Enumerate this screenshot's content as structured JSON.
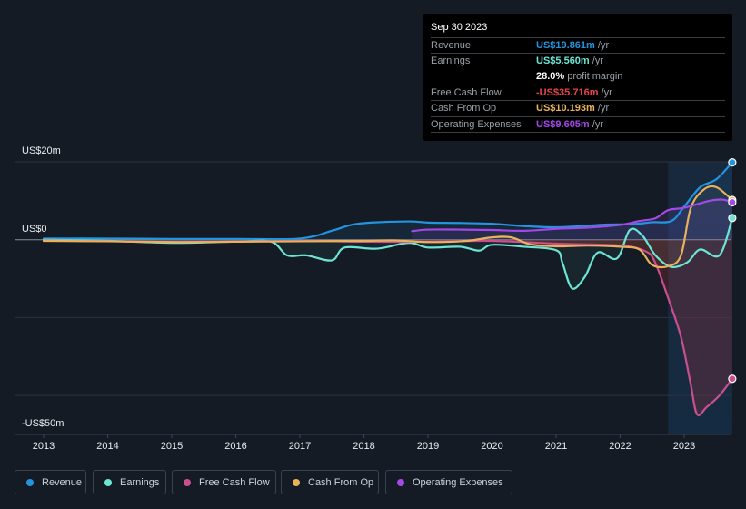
{
  "tooltip": {
    "date": "Sep 30 2023",
    "rows": [
      {
        "label": "Revenue",
        "value": "US$19.861m",
        "unit": " /yr",
        "color": "#2394df"
      },
      {
        "label": "Earnings",
        "value": "US$5.560m",
        "unit": " /yr",
        "color": "#6ce5d4"
      },
      {
        "label": "",
        "value": "28.0%",
        "unit": " profit margin",
        "color": "#ffffff"
      },
      {
        "label": "Free Cash Flow",
        "value": "-US$35.716m",
        "unit": " /yr",
        "color": "#e64545"
      },
      {
        "label": "Cash From Op",
        "value": "US$10.193m",
        "unit": " /yr",
        "color": "#e9b15c"
      },
      {
        "label": "Operating Expenses",
        "value": "US$9.605m",
        "unit": " /yr",
        "color": "#a448e8"
      }
    ]
  },
  "legend": [
    {
      "label": "Revenue",
      "color": "#2394df"
    },
    {
      "label": "Earnings",
      "color": "#6ce5d4"
    },
    {
      "label": "Free Cash Flow",
      "color": "#c94f8e"
    },
    {
      "label": "Cash From Op",
      "color": "#e9b15c"
    },
    {
      "label": "Operating Expenses",
      "color": "#a448e8"
    }
  ],
  "chart_data": {
    "type": "line",
    "title": "",
    "xlabel": "",
    "ylabel": "",
    "unit": "US$ m",
    "xlim": [
      2013,
      2023.75
    ],
    "ylim": [
      -50,
      20
    ],
    "y_tick_labels": [
      {
        "value": 20,
        "label": "US$20m"
      },
      {
        "value": 0,
        "label": "US$0"
      },
      {
        "value": -50,
        "label": "-US$50m"
      }
    ],
    "y_gridlines": [
      20,
      0,
      -20,
      -40
    ],
    "x_tick_labels": [
      "2013",
      "2014",
      "2015",
      "2016",
      "2017",
      "2018",
      "2019",
      "2020",
      "2021",
      "2022",
      "2023"
    ],
    "highlight_range": [
      2022.75,
      2023.75
    ],
    "legend_position": "bottom",
    "series": [
      {
        "name": "Revenue",
        "color": "#2394df",
        "points": [
          [
            2013,
            0.3
          ],
          [
            2014,
            0.3
          ],
          [
            2015,
            0.2
          ],
          [
            2016,
            0.2
          ],
          [
            2017,
            0.3
          ],
          [
            2017.5,
            2.3
          ],
          [
            2017.8,
            3.8
          ],
          [
            2018.1,
            4.4
          ],
          [
            2018.7,
            4.7
          ],
          [
            2019.0,
            4.4
          ],
          [
            2019.5,
            4.3
          ],
          [
            2020.0,
            4.1
          ],
          [
            2020.5,
            3.5
          ],
          [
            2021.0,
            3.2
          ],
          [
            2021.5,
            3.6
          ],
          [
            2021.8,
            3.9
          ],
          [
            2022.2,
            4.0
          ],
          [
            2022.5,
            4.5
          ],
          [
            2022.8,
            4.8
          ],
          [
            2023.0,
            8.5
          ],
          [
            2023.25,
            13.5
          ],
          [
            2023.5,
            15.5
          ],
          [
            2023.75,
            19.861
          ]
        ]
      },
      {
        "name": "Earnings",
        "color": "#6ce5d4",
        "points": [
          [
            2013,
            0
          ],
          [
            2014,
            -0.3
          ],
          [
            2015,
            -0.8
          ],
          [
            2016,
            -0.5
          ],
          [
            2016.55,
            -0.5
          ],
          [
            2016.8,
            -4.0
          ],
          [
            2017.1,
            -4.0
          ],
          [
            2017.5,
            -5.3
          ],
          [
            2017.7,
            -2.0
          ],
          [
            2018.2,
            -2.3
          ],
          [
            2018.7,
            -0.8
          ],
          [
            2019.0,
            -2.0
          ],
          [
            2019.5,
            -1.8
          ],
          [
            2019.8,
            -2.8
          ],
          [
            2020.0,
            -1.3
          ],
          [
            2020.5,
            -1.8
          ],
          [
            2021.0,
            -2.7
          ],
          [
            2021.1,
            -6.0
          ],
          [
            2021.25,
            -12.5
          ],
          [
            2021.45,
            -9.5
          ],
          [
            2021.65,
            -3.3
          ],
          [
            2021.95,
            -4.8
          ],
          [
            2022.15,
            2.5
          ],
          [
            2022.35,
            1.0
          ],
          [
            2022.55,
            -4.0
          ],
          [
            2022.8,
            -7.0
          ],
          [
            2023.05,
            -5.8
          ],
          [
            2023.25,
            -2.5
          ],
          [
            2023.55,
            -4.0
          ],
          [
            2023.75,
            5.56
          ]
        ]
      },
      {
        "name": "Free Cash Flow",
        "color": "#c94f8e",
        "points": [
          [
            2013,
            -0.2
          ],
          [
            2015,
            -0.5
          ],
          [
            2017,
            -0.3
          ],
          [
            2018,
            -0.5
          ],
          [
            2019,
            -0.5
          ],
          [
            2020,
            -0.3
          ],
          [
            2021,
            -1.0
          ],
          [
            2022,
            -1.5
          ],
          [
            2022.4,
            -3.0
          ],
          [
            2022.55,
            -6.0
          ],
          [
            2022.75,
            -15.0
          ],
          [
            2022.95,
            -25.0
          ],
          [
            2023.1,
            -37.0
          ],
          [
            2023.2,
            -44.8
          ],
          [
            2023.35,
            -43.0
          ],
          [
            2023.55,
            -40.0
          ],
          [
            2023.75,
            -35.716
          ]
        ]
      },
      {
        "name": "Cash From Op",
        "color": "#e9b15c",
        "points": [
          [
            2013,
            -0.3
          ],
          [
            2014,
            -0.4
          ],
          [
            2015,
            -0.6
          ],
          [
            2016,
            -0.5
          ],
          [
            2017,
            -0.4
          ],
          [
            2018,
            -0.3
          ],
          [
            2018.5,
            -0.2
          ],
          [
            2019,
            -0.6
          ],
          [
            2019.6,
            -0.3
          ],
          [
            2020.0,
            0.6
          ],
          [
            2020.3,
            0.6
          ],
          [
            2020.6,
            -1.2
          ],
          [
            2021.0,
            -1.7
          ],
          [
            2021.5,
            -1.5
          ],
          [
            2022.0,
            -1.8
          ],
          [
            2022.3,
            -2.5
          ],
          [
            2022.5,
            -6.5
          ],
          [
            2022.75,
            -6.8
          ],
          [
            2022.95,
            -4.0
          ],
          [
            2023.1,
            8.0
          ],
          [
            2023.3,
            12.8
          ],
          [
            2023.5,
            13.5
          ],
          [
            2023.75,
            10.193
          ]
        ]
      },
      {
        "name": "Operating Expenses",
        "color": "#a448e8",
        "points": [
          [
            2018.75,
            2.2
          ],
          [
            2019.0,
            2.6
          ],
          [
            2019.5,
            2.6
          ],
          [
            2020.0,
            2.5
          ],
          [
            2020.5,
            2.3
          ],
          [
            2021.0,
            2.8
          ],
          [
            2021.5,
            3.1
          ],
          [
            2022.0,
            3.8
          ],
          [
            2022.3,
            4.8
          ],
          [
            2022.55,
            5.5
          ],
          [
            2022.75,
            7.6
          ],
          [
            2023.0,
            8.2
          ],
          [
            2023.4,
            10.0
          ],
          [
            2023.6,
            10.3
          ],
          [
            2023.75,
            9.605
          ]
        ]
      }
    ]
  }
}
